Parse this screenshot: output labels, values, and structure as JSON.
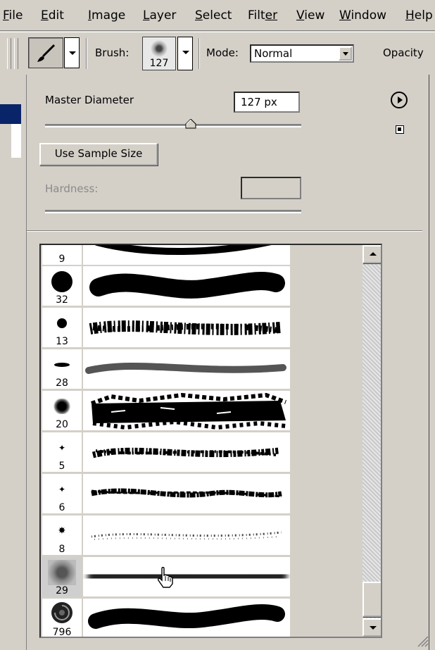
{
  "menubar": {
    "items": [
      {
        "first": "F",
        "rest": "ile"
      },
      {
        "first": "E",
        "rest": "dit"
      },
      {
        "first": "I",
        "rest": "mage"
      },
      {
        "first": "L",
        "rest": "ayer"
      },
      {
        "first": "S",
        "rest": "elect"
      },
      {
        "first": "Filt",
        "rest": "er"
      },
      {
        "first": "V",
        "rest": "iew"
      },
      {
        "first": "W",
        "rest": "indow"
      },
      {
        "first": "H",
        "rest": "elp"
      }
    ]
  },
  "options": {
    "brush_label": "Brush:",
    "brush_size": "127",
    "mode_label": "Mode:",
    "mode_value": "Normal",
    "opacity_label": "Opacity"
  },
  "panel": {
    "master_diameter_label": "Master Diameter",
    "master_diameter_value": "127 px",
    "master_diameter_fraction": 0.57,
    "use_sample_size_label": "Use Sample Size",
    "hardness_label": "Hardness:",
    "hardness_value": ""
  },
  "brushes": [
    {
      "size": "9",
      "thumb": "dot",
      "stroke": "thin"
    },
    {
      "size": "32",
      "thumb": "dot",
      "stroke": "hard"
    },
    {
      "size": "13",
      "thumb": "dot",
      "stroke": "spatter"
    },
    {
      "size": "28",
      "thumb": "flat",
      "stroke": "flat"
    },
    {
      "size": "20",
      "thumb": "rough",
      "stroke": "chalk"
    },
    {
      "size": "5",
      "thumb": "star",
      "stroke": "spatter-thin"
    },
    {
      "size": "6",
      "thumb": "star",
      "stroke": "rope"
    },
    {
      "size": "8",
      "thumb": "star",
      "stroke": "dotted"
    },
    {
      "size": "29",
      "thumb": "texture",
      "stroke": "soft"
    },
    {
      "size": "796",
      "thumb": "shell",
      "stroke": "hard"
    }
  ],
  "colors": {
    "chrome": "#d4d0c8",
    "title_blue": "#0a246a"
  }
}
